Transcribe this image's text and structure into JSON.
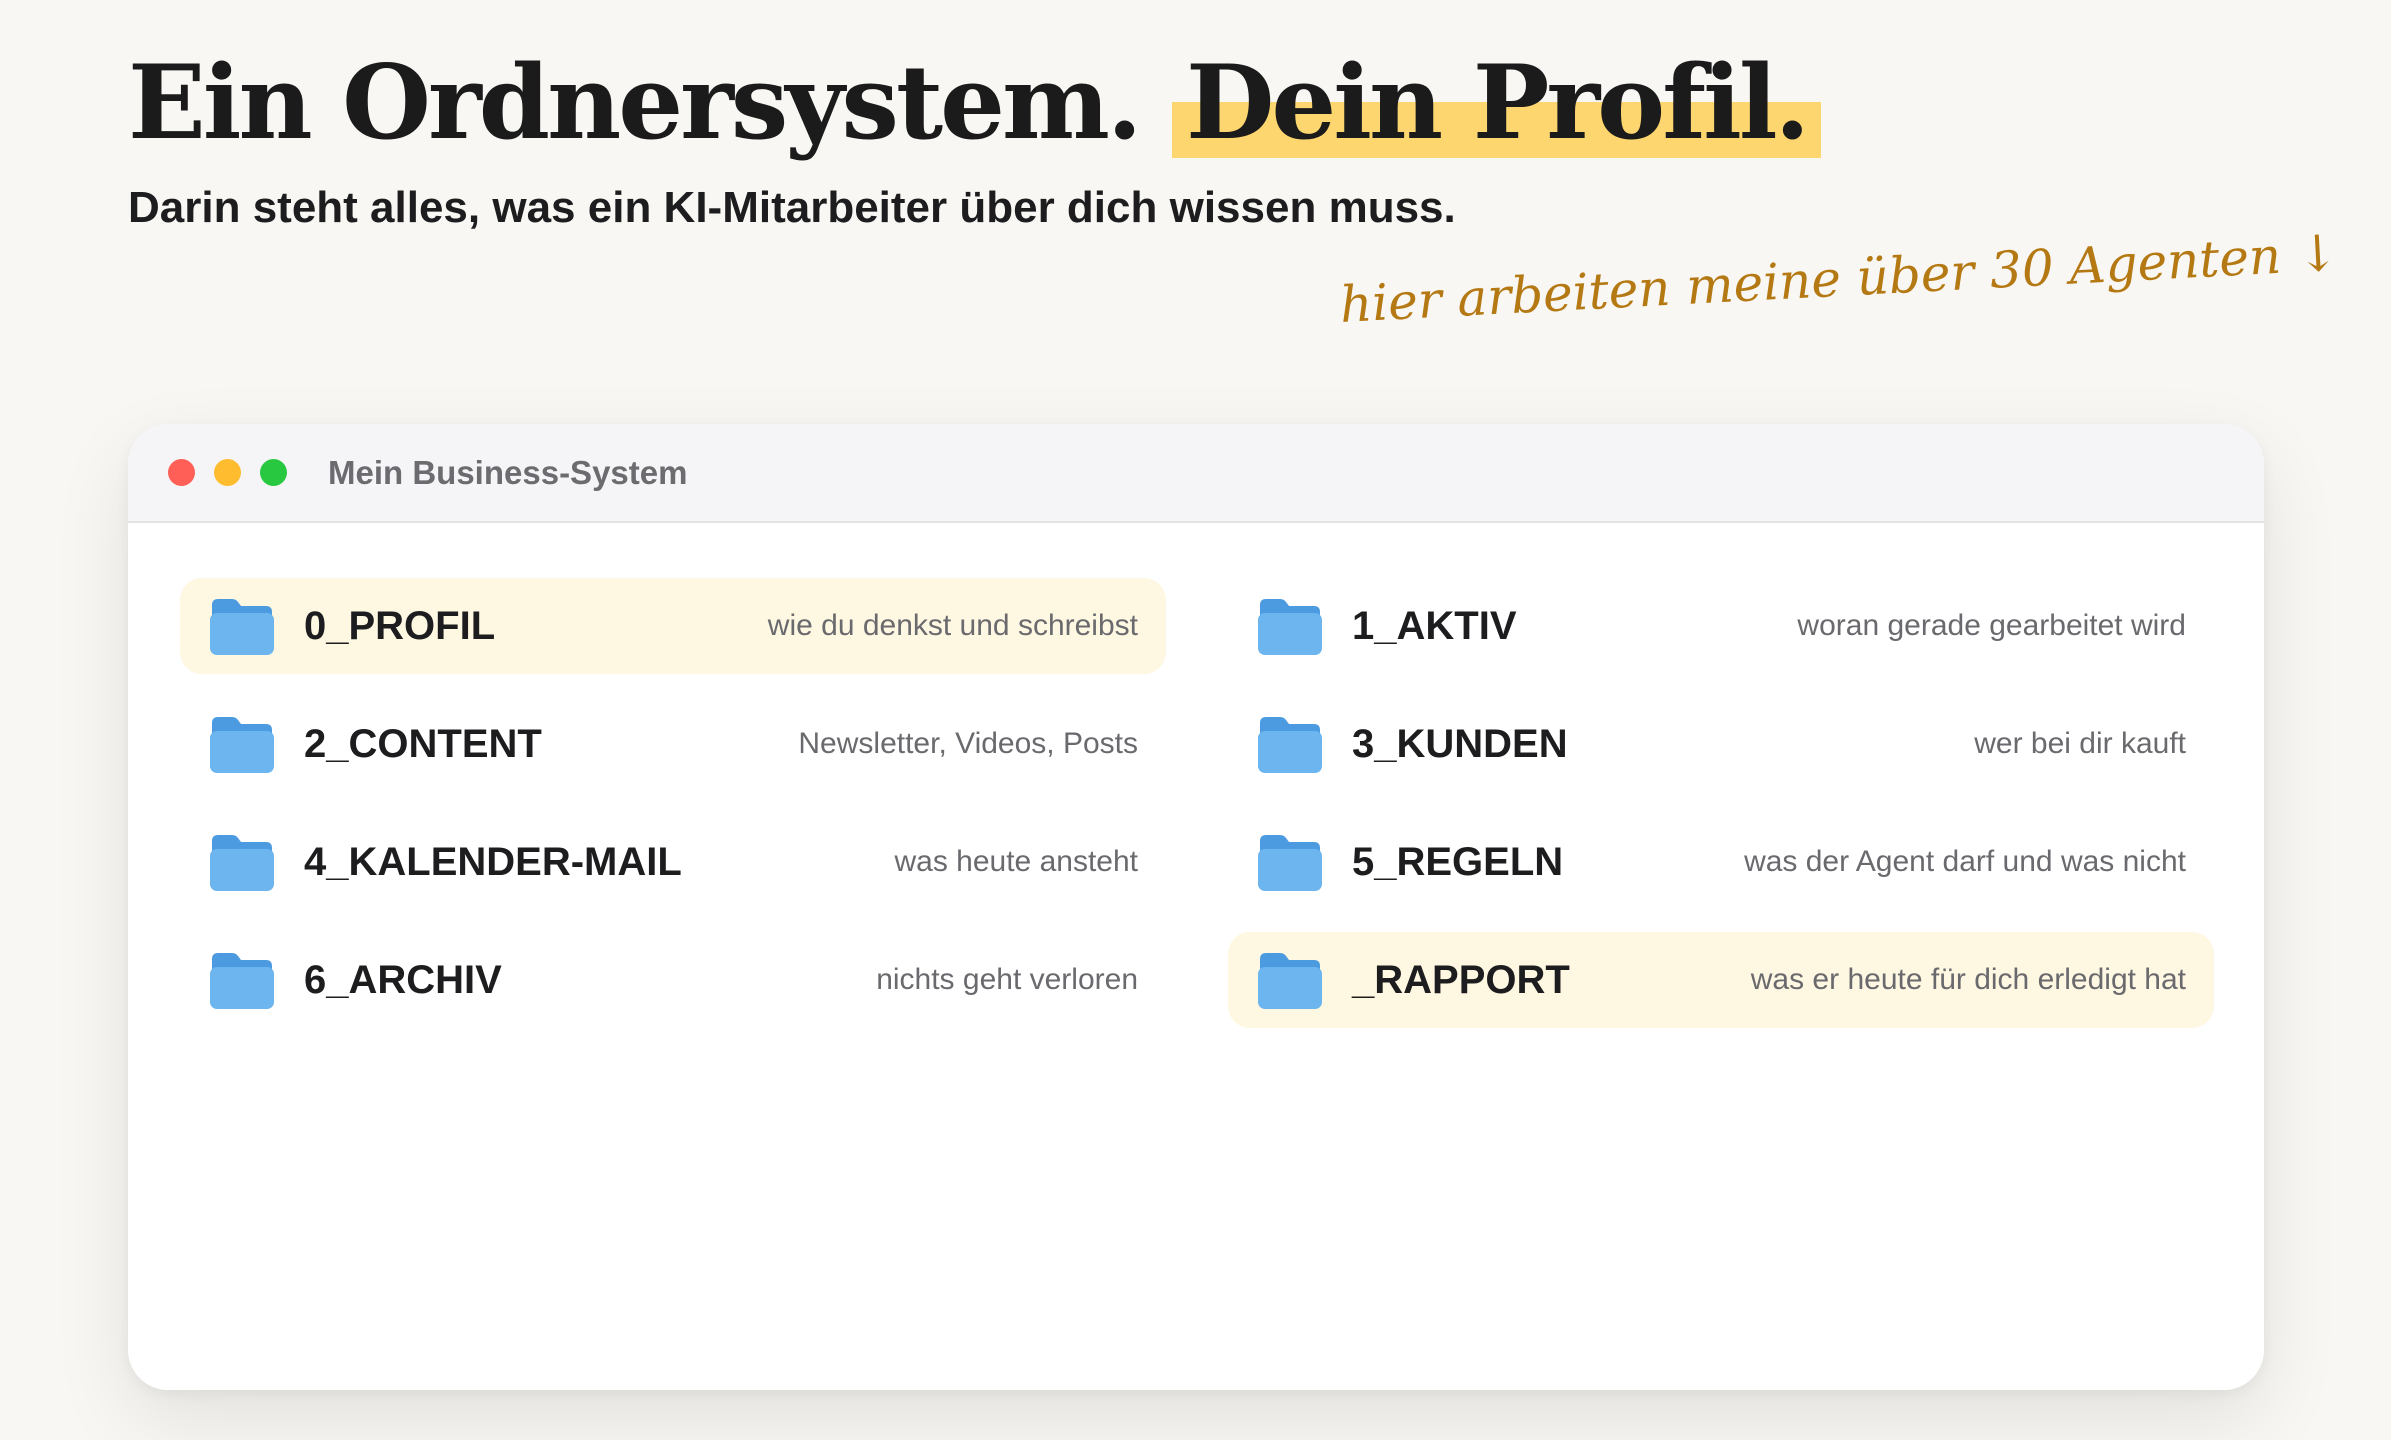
{
  "headline": {
    "part1": "Ein Ordnersystem.",
    "part2": "Dein Profil."
  },
  "subline": "Darin steht alles, was ein KI-Mitarbeiter über dich wissen muss.",
  "handnote": "hier arbeiten meine über 30 Agenten ↓",
  "colors": {
    "accent_highlight": "#fdd670",
    "handnote": "#b57914",
    "folder_blue": "#5ba8e8",
    "row_highlight": "#fef7e1",
    "dot_red": "#ff5f57",
    "dot_yellow": "#febc2e",
    "dot_green": "#28c840"
  },
  "window": {
    "title": "Mein Business-System",
    "folders": [
      {
        "name": "0_PROFIL",
        "desc": "wie du denkst und schreibst",
        "icon": "folder-icon",
        "highlighted": true
      },
      {
        "name": "1_AKTIV",
        "desc": "woran gerade gearbeitet wird",
        "icon": "folder-icon",
        "highlighted": false
      },
      {
        "name": "2_CONTENT",
        "desc": "Newsletter, Videos, Posts",
        "icon": "folder-icon",
        "highlighted": false
      },
      {
        "name": "3_KUNDEN",
        "desc": "wer bei dir kauft",
        "icon": "folder-icon",
        "highlighted": false
      },
      {
        "name": "4_KALENDER-MAIL",
        "desc": "was heute ansteht",
        "icon": "folder-icon",
        "highlighted": false
      },
      {
        "name": "5_REGELN",
        "desc": "was der Agent darf und was nicht",
        "icon": "folder-icon",
        "highlighted": false
      },
      {
        "name": "6_ARCHIV",
        "desc": "nichts geht verloren",
        "icon": "folder-icon",
        "highlighted": false
      },
      {
        "name": "_RAPPORT",
        "desc": "was er heute für dich erledigt hat",
        "icon": "folder-icon",
        "highlighted": true
      }
    ]
  }
}
